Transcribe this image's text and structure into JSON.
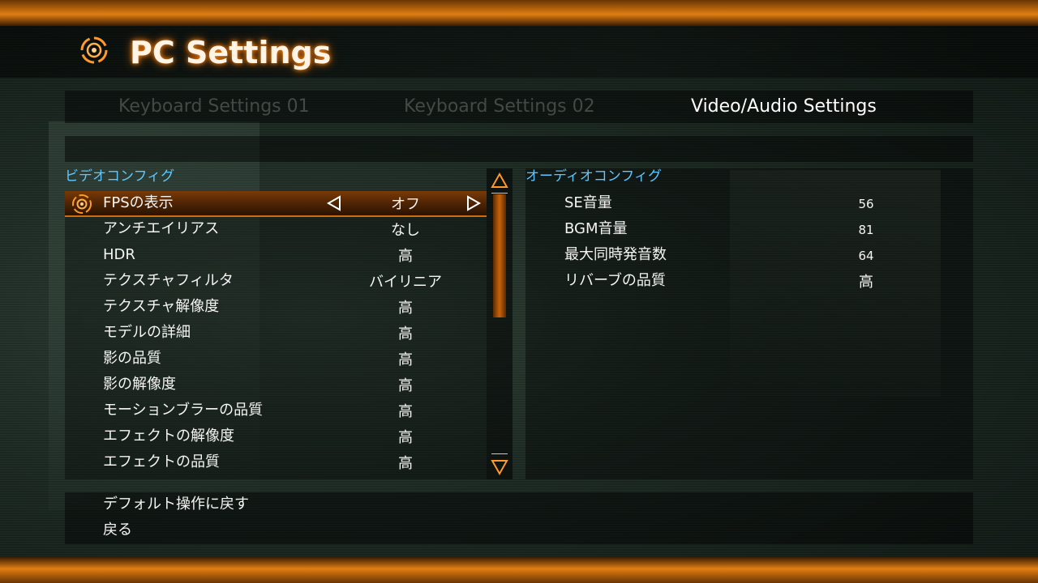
{
  "header": {
    "title": "PC Settings"
  },
  "tabs": [
    {
      "label": "Keyboard Settings 01"
    },
    {
      "label": "Keyboard Settings 02"
    },
    {
      "label": "Video/Audio Settings"
    }
  ],
  "video": {
    "title": "ビデオコンフィグ",
    "items": [
      {
        "label": "FPSの表示",
        "value": "オフ"
      },
      {
        "label": "アンチエイリアス",
        "value": "なし"
      },
      {
        "label": "HDR",
        "value": "高"
      },
      {
        "label": "テクスチャフィルタ",
        "value": "バイリニア"
      },
      {
        "label": "テクスチャ解像度",
        "value": "高"
      },
      {
        "label": "モデルの詳細",
        "value": "高"
      },
      {
        "label": "影の品質",
        "value": "高"
      },
      {
        "label": "影の解像度",
        "value": "高"
      },
      {
        "label": "モーションブラーの品質",
        "value": "高"
      },
      {
        "label": "エフェクトの解像度",
        "value": "高"
      },
      {
        "label": "エフェクトの品質",
        "value": "高"
      }
    ]
  },
  "audio": {
    "title": "オーディオコンフィグ",
    "items": [
      {
        "label": "SE音量",
        "value": "56"
      },
      {
        "label": "BGM音量",
        "value": "81"
      },
      {
        "label": "最大同時発音数",
        "value": "64"
      },
      {
        "label": "リバーブの品質",
        "value": "高"
      }
    ]
  },
  "bottom": {
    "reset": "デフォルト操作に戻す",
    "back": "戻る"
  },
  "colors": {
    "accent": "#e07e12",
    "section_heading": "#5fc7ff",
    "selected_row": "#7a3a06"
  },
  "icons": {
    "logo": "target-ring-icon",
    "selected": "target-ring-icon",
    "left": "triangle-left-icon",
    "right": "triangle-right-icon",
    "up": "triangle-up-icon",
    "down": "triangle-down-icon"
  }
}
